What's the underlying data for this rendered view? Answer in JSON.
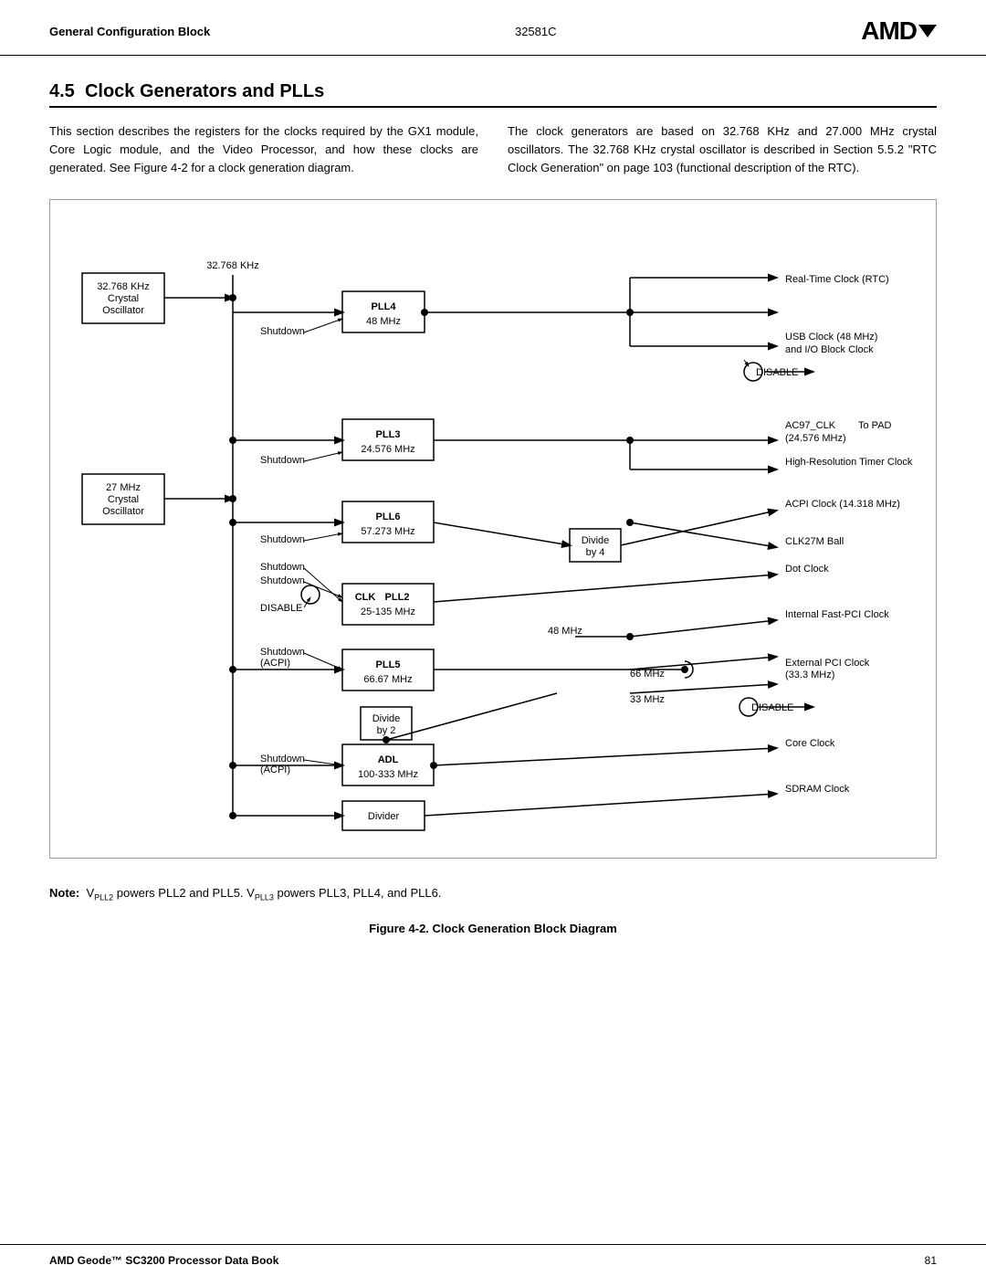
{
  "header": {
    "left": "General Configuration Block",
    "center": "32581C",
    "logo": "AMD؆"
  },
  "section": {
    "number": "4.5",
    "title": "Clock Generators and PLLs",
    "col1": "This section describes the registers for the clocks required by the GX1 module, Core Logic module, and the Video Processor, and how these clocks are generated. See Figure 4-2 for a clock generation diagram.",
    "col2": "The clock generators are based on 32.768 KHz and 27.000 MHz crystal oscillators. The 32.768 KHz crystal oscillator is described in Section 5.5.2 \"RTC Clock Generation\" on page 103 (functional description of the RTC)."
  },
  "figure": {
    "caption": "Figure 4-2.  Clock Generation Block Diagram"
  },
  "note": {
    "label": "Note:",
    "text": "V"
  },
  "footer": {
    "left": "AMD Geode™ SC3200 Processor Data Book",
    "right": "81"
  }
}
